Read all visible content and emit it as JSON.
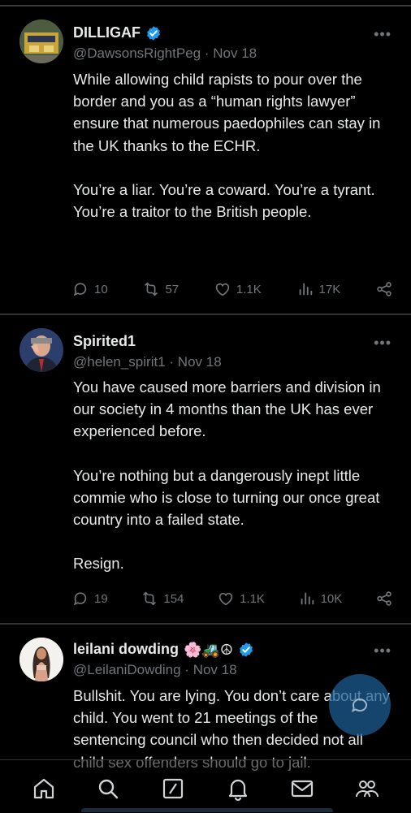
{
  "colors": {
    "accent": "#1d9bf0",
    "muted": "#71767b",
    "text": "#e7e9ea",
    "background": "#000000"
  },
  "tweets": [
    {
      "name": "DILLIGAF",
      "handle": "@DawsonsRightPeg",
      "separator": "·",
      "date": "Nov 18",
      "verified": true,
      "paragraphs": [
        "While allowing child rapists to pour over the border and you as a “human rights lawyer” ensure that numerous paedophiles can stay in the UK thanks to the ECHR.",
        "You’re a liar. You’re a coward. You’re a tyrant. You’re a traitor to the British people."
      ],
      "replies": "10",
      "reposts": "57",
      "likes": "1.1K",
      "views": "17K"
    },
    {
      "name": "Spirited1",
      "handle": "@helen_spirit1",
      "separator": "·",
      "date": "Nov 18",
      "verified": false,
      "paragraphs": [
        "You have caused more barriers and division in our society in 4 months than the UK has ever experienced before.",
        "You’re nothing but a dangerously inept little commie who is close to turning our once great country into a failed state.",
        "Resign."
      ],
      "replies": "19",
      "reposts": "154",
      "likes": "1.1K",
      "views": "10K"
    },
    {
      "name": "leilani dowding",
      "name_emojis": "🌸🚜☮",
      "handle": "@LeilaniDowding",
      "separator": "·",
      "date": "Nov 18",
      "verified": true,
      "paragraphs": [
        "Bullshit. You are lying.  You don’t care about any child.  You went to 21 meetings of the sentencing council who then decided not all child sex offenders should go to jail."
      ]
    }
  ],
  "more_glyph": "•••",
  "icons": [
    "reply-icon",
    "repost-icon",
    "like-icon",
    "views-icon",
    "share-icon",
    "more-icon",
    "verified-icon",
    "compose-icon",
    "home-icon",
    "search-icon",
    "grok-icon",
    "notifications-icon",
    "messages-icon",
    "communities-icon"
  ]
}
